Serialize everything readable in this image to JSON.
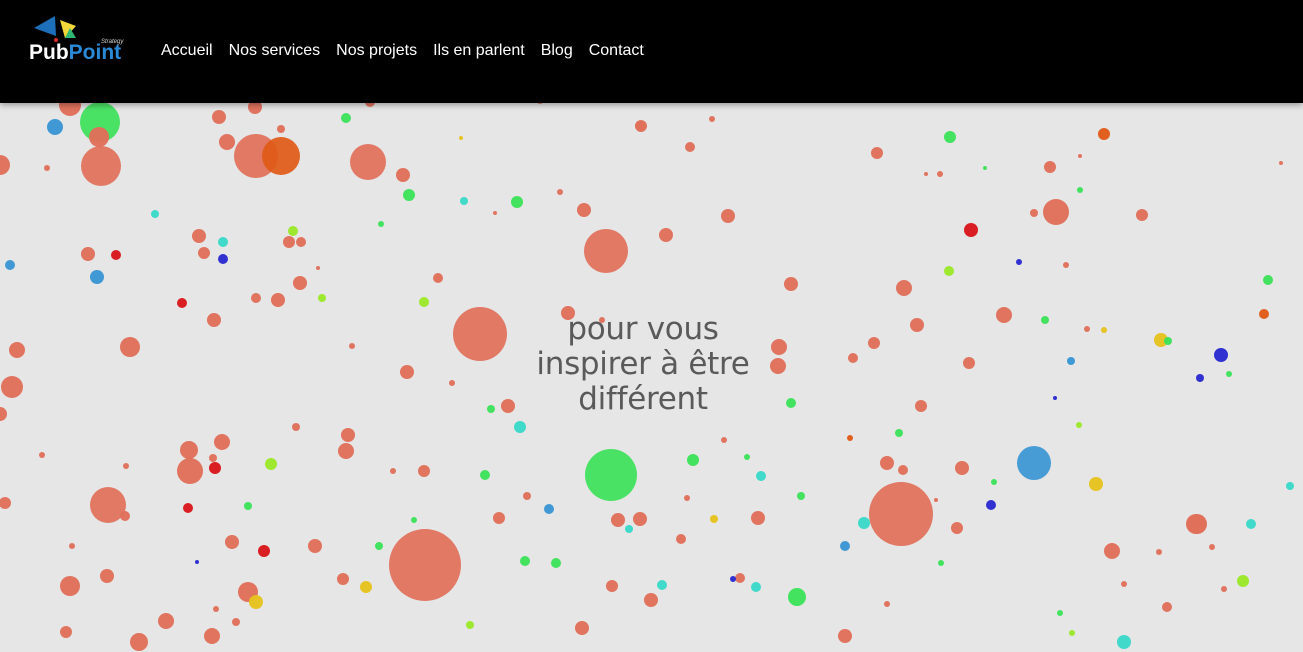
{
  "brand": {
    "name_part1": "Pub",
    "name_part2": "Point",
    "tagline": "Strategy",
    "colors": {
      "dark_blue": "#1c6fb8",
      "light_blue": "#2a8ad6",
      "yellow": "#f2d63a",
      "green": "#2eb872",
      "red": "#d92a2a"
    }
  },
  "nav": {
    "items": [
      {
        "label": "Accueil",
        "name": "nav-accueil"
      },
      {
        "label": "Nos services",
        "name": "nav-nos-services"
      },
      {
        "label": "Nos projets",
        "name": "nav-nos-projets"
      },
      {
        "label": "Ils en parlent",
        "name": "nav-ils-en-parlent"
      },
      {
        "label": "Blog",
        "name": "nav-blog"
      },
      {
        "label": "Contact",
        "name": "nav-contact"
      }
    ]
  },
  "hero": {
    "tagline_line1": "pour vous",
    "tagline_line2": "inspirer à être",
    "tagline_line3": "différent",
    "colors": {
      "background": "#e6e6e6",
      "text": "#5a5a5a",
      "bubble_main": "#e0705a",
      "bubble_green": "#3de15a",
      "bubble_blue": "#3a96d4",
      "bubble_red": "#d8181c",
      "bubble_orange": "#e05a18",
      "bubble_cyan": "#3ad8c8",
      "bubble_yellow": "#e6c21e",
      "bubble_navy": "#2a2ad0",
      "bubble_lime": "#9be828"
    }
  }
}
